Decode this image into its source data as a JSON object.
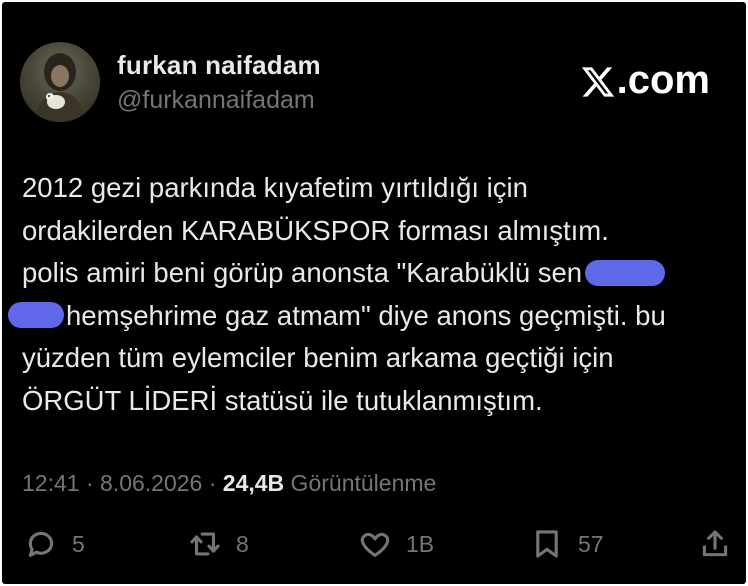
{
  "author": {
    "display_name": "furkan naifadam",
    "handle": "@furkannaifadam",
    "avatar_icon": "profile-photo-avatar"
  },
  "brand": {
    "text": ".com",
    "logo_icon": "x-logo-icon"
  },
  "tweet": {
    "line1": "2012 gezi parkında kıyafetim yırtıldığı için",
    "line2": "ordakilerden KARABÜKSPOR forması almıştım.",
    "line3": "polis amiri beni görüp anonsta \"Karabüklü sen",
    "line4": "hemşehrime gaz atmam\" diye anons geçmişti. bu",
    "line5": "yüzden tüm eylemciler benim arkama geçtiği için",
    "line6": "ÖRGÜT LİDERİ statüsü ile tutuklanmıştım.",
    "redaction_color": "#5e68e9"
  },
  "meta": {
    "time": "12:41",
    "sep1": " · ",
    "date": "8.06.2026",
    "sep2": " · ",
    "views_count": "24,4B",
    "views_label": " Görüntülenme"
  },
  "actions": {
    "reply_count": "5",
    "retweet_count": "8",
    "like_count": "1B",
    "bookmark_count": "57"
  },
  "colors": {
    "background": "#000000",
    "text": "#e7e9ea",
    "muted": "#71767b"
  }
}
